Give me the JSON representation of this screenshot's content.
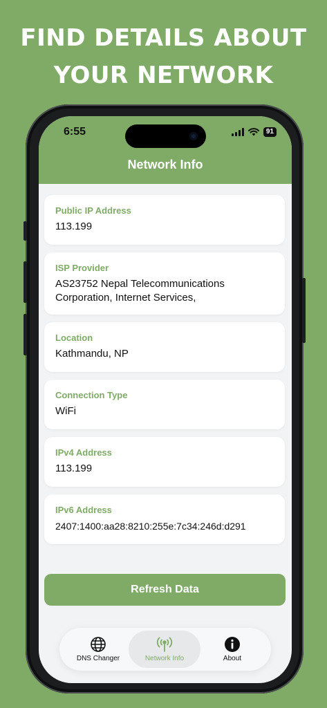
{
  "headline": {
    "line1": "FIND DETAILS ABOUT",
    "line2": "YOUR NETWORK"
  },
  "status_bar": {
    "time": "6:55",
    "battery": "91"
  },
  "app": {
    "title": "Network Info"
  },
  "cards": [
    {
      "label": "Public IP Address",
      "value": "113.199"
    },
    {
      "label": "ISP Provider",
      "value": "AS23752 Nepal Telecommunications Corporation, Internet Services,"
    },
    {
      "label": "Location",
      "value": "Kathmandu, NP"
    },
    {
      "label": "Connection Type",
      "value": "WiFi"
    },
    {
      "label": "IPv4 Address",
      "value": "113.199"
    },
    {
      "label": "IPv6 Address",
      "value": "2407:1400:aa28:8210:255e:7c34:246d:d291"
    }
  ],
  "refresh_label": "Refresh Data",
  "tabs": [
    {
      "label": "DNS Changer",
      "icon": "globe-icon"
    },
    {
      "label": "Network Info",
      "icon": "antenna-icon",
      "active": true
    },
    {
      "label": "About",
      "icon": "info-icon"
    }
  ],
  "colors": {
    "accent": "#7fab67",
    "background": "#7fab67",
    "screen_bg": "#f2f3f4"
  }
}
